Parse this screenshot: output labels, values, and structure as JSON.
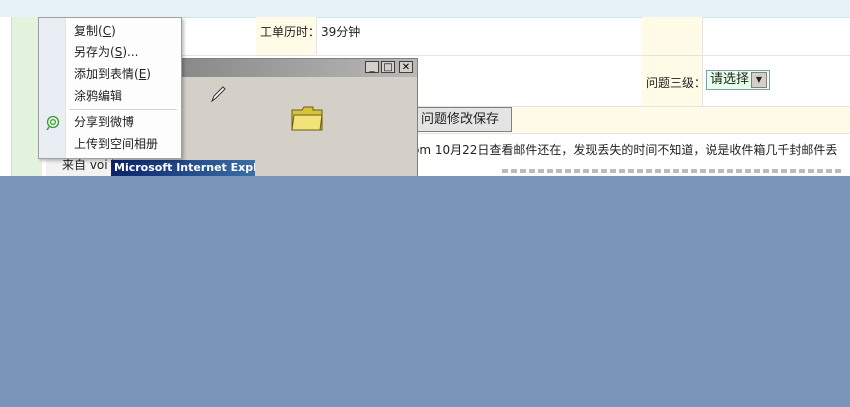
{
  "form": {
    "work_hours_label": "工单历时：",
    "work_hours_value": "39分钟",
    "level3_label": "问题三级：",
    "level3_select_value": "请选择",
    "save_button": "问题修改保存",
    "message_text": "om 10月22日查看邮件还在，发现丢失的时间不知道，说是收件箱几千封邮件丢",
    "from_prefix": "来自 voi"
  },
  "dialog": {
    "minimize_glyph": "_",
    "maximize_glyph": "□",
    "close_glyph": "✕"
  },
  "ie_caption": "Microsoft Internet Explor…",
  "context_menu": {
    "items": [
      {
        "label": "复制",
        "accel": "C",
        "suffix": ""
      },
      {
        "label": "另存为",
        "accel": "S",
        "suffix": "..."
      },
      {
        "label": "添加到表情",
        "accel": "E",
        "suffix": ""
      },
      {
        "label": "涂鸦编辑",
        "accel": "",
        "suffix": ""
      },
      {
        "label": "分享到微博",
        "accel": "",
        "suffix": ""
      },
      {
        "label": "上传到空间相册",
        "accel": "",
        "suffix": ""
      }
    ]
  },
  "icons": {
    "share_weibo": "weibo-share-icon",
    "folder": "folder-icon",
    "pen": "pen-icon"
  },
  "colors": {
    "overlay_blue": "#7b94b9",
    "label_bg": "#fffbe6",
    "rail_green": "#e3f3de",
    "select_bg": "#e6ffe6"
  }
}
